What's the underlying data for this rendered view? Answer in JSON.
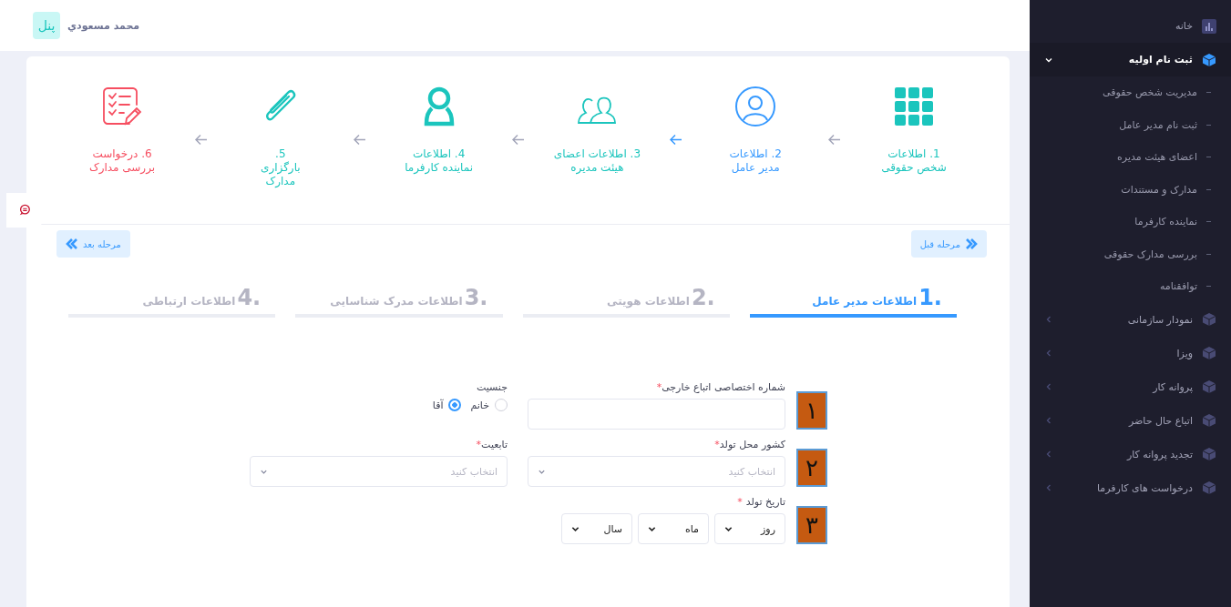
{
  "header": {
    "logo": "پنل",
    "user_name": "محمد مسعودي"
  },
  "sidebar": {
    "items": [
      {
        "kind": "home",
        "label": "خانه",
        "selected": false
      },
      {
        "kind": "group",
        "label": "ثبت نام اولیه",
        "selected": true,
        "expanded": true,
        "children": [
          {
            "label": "مدیریت شخص حقوقی",
            "selected": false
          },
          {
            "label": "ثبت نام مدیر عامل",
            "selected": false
          },
          {
            "label": "اعضای هیئت مدیره",
            "selected": false
          },
          {
            "label": "مدارک و مستندات",
            "selected": false
          },
          {
            "label": "نماینده کارفرما",
            "selected": false
          },
          {
            "label": "بررسی مدارک حقوقی",
            "selected": false
          },
          {
            "label": "توافقنامه",
            "selected": false
          }
        ]
      },
      {
        "kind": "group",
        "label": "نمودار سازمانی",
        "selected": false,
        "expanded": false
      },
      {
        "kind": "group",
        "label": "ویزا",
        "selected": false,
        "expanded": false
      },
      {
        "kind": "group",
        "label": "پروانه کار",
        "selected": false,
        "expanded": false
      },
      {
        "kind": "group",
        "label": "اتباع حال حاضر",
        "selected": false,
        "expanded": false
      },
      {
        "kind": "group",
        "label": "تجدید پروانه کار",
        "selected": false,
        "expanded": false
      },
      {
        "kind": "group",
        "label": "درخواست های کارفرما",
        "selected": false,
        "expanded": false
      }
    ]
  },
  "stepper": {
    "steps": [
      {
        "kind": "grid",
        "color": "#1bc5bd",
        "selected": false,
        "lines": [
          "1. اطلاعات",
          "شخص حقوقی"
        ]
      },
      {
        "kind": "person",
        "selected": true,
        "lines": [
          "2. اطلاعات",
          "مدیر عامل"
        ]
      },
      {
        "kind": "people",
        "color": "#1bc5bd",
        "selected": false,
        "lines": [
          "3. اطلاعات اعضای",
          "هیئت مدیره"
        ]
      },
      {
        "kind": "figure",
        "color": "#1bc5bd",
        "selected": false,
        "lines": [
          "4. اطلاعات",
          "نماینده کارفرما"
        ]
      },
      {
        "kind": "attachment",
        "color": "#1bc5bd",
        "selected": false,
        "lines": [
          "5.",
          "بارگزاری",
          "مدارک"
        ]
      },
      {
        "kind": "checklist",
        "color": "#f64e60",
        "selected": false,
        "lines": [
          "6. درخواست",
          "بررسی مدارک"
        ]
      }
    ]
  },
  "nav_buttons": {
    "previous": "مرحله قبل",
    "next": "مرحله بعد"
  },
  "tabs": [
    {
      "number": "1.",
      "label": "اطلاعات مدیر عامل",
      "selected": true
    },
    {
      "number": "2.",
      "label": "اطلاعات هویتی",
      "selected": false
    },
    {
      "number": "3.",
      "label": "اطلاعات مدرک شناسایی",
      "selected": false
    },
    {
      "number": "4.",
      "label": "اطلاعات ارتباطی",
      "selected": false
    }
  ],
  "form": {
    "rows": [
      {
        "badge": "١",
        "fields": [
          {
            "kind": "text",
            "label": "شماره اختصاصی اتباع خارجی",
            "required_mark": "*"
          },
          {
            "kind": "radio",
            "label": "جنسیت",
            "options": [
              {
                "label": "خانم",
                "selected": false
              },
              {
                "label": "آقا",
                "selected": true
              }
            ]
          }
        ]
      },
      {
        "badge": "٢",
        "fields": [
          {
            "kind": "select",
            "label": "کشور محل تولد",
            "required_mark": "*",
            "placeholder": "انتخاب کنید"
          },
          {
            "kind": "select",
            "label": "تابعیت",
            "required_mark": "*",
            "placeholder": "انتخاب کنید"
          }
        ]
      },
      {
        "badge": "٣",
        "fields": [
          {
            "kind": "date",
            "label": "تاریخ تولد",
            "required_mark": "*",
            "parts": [
              "روز",
              "ماه",
              "سال"
            ]
          }
        ]
      }
    ]
  }
}
